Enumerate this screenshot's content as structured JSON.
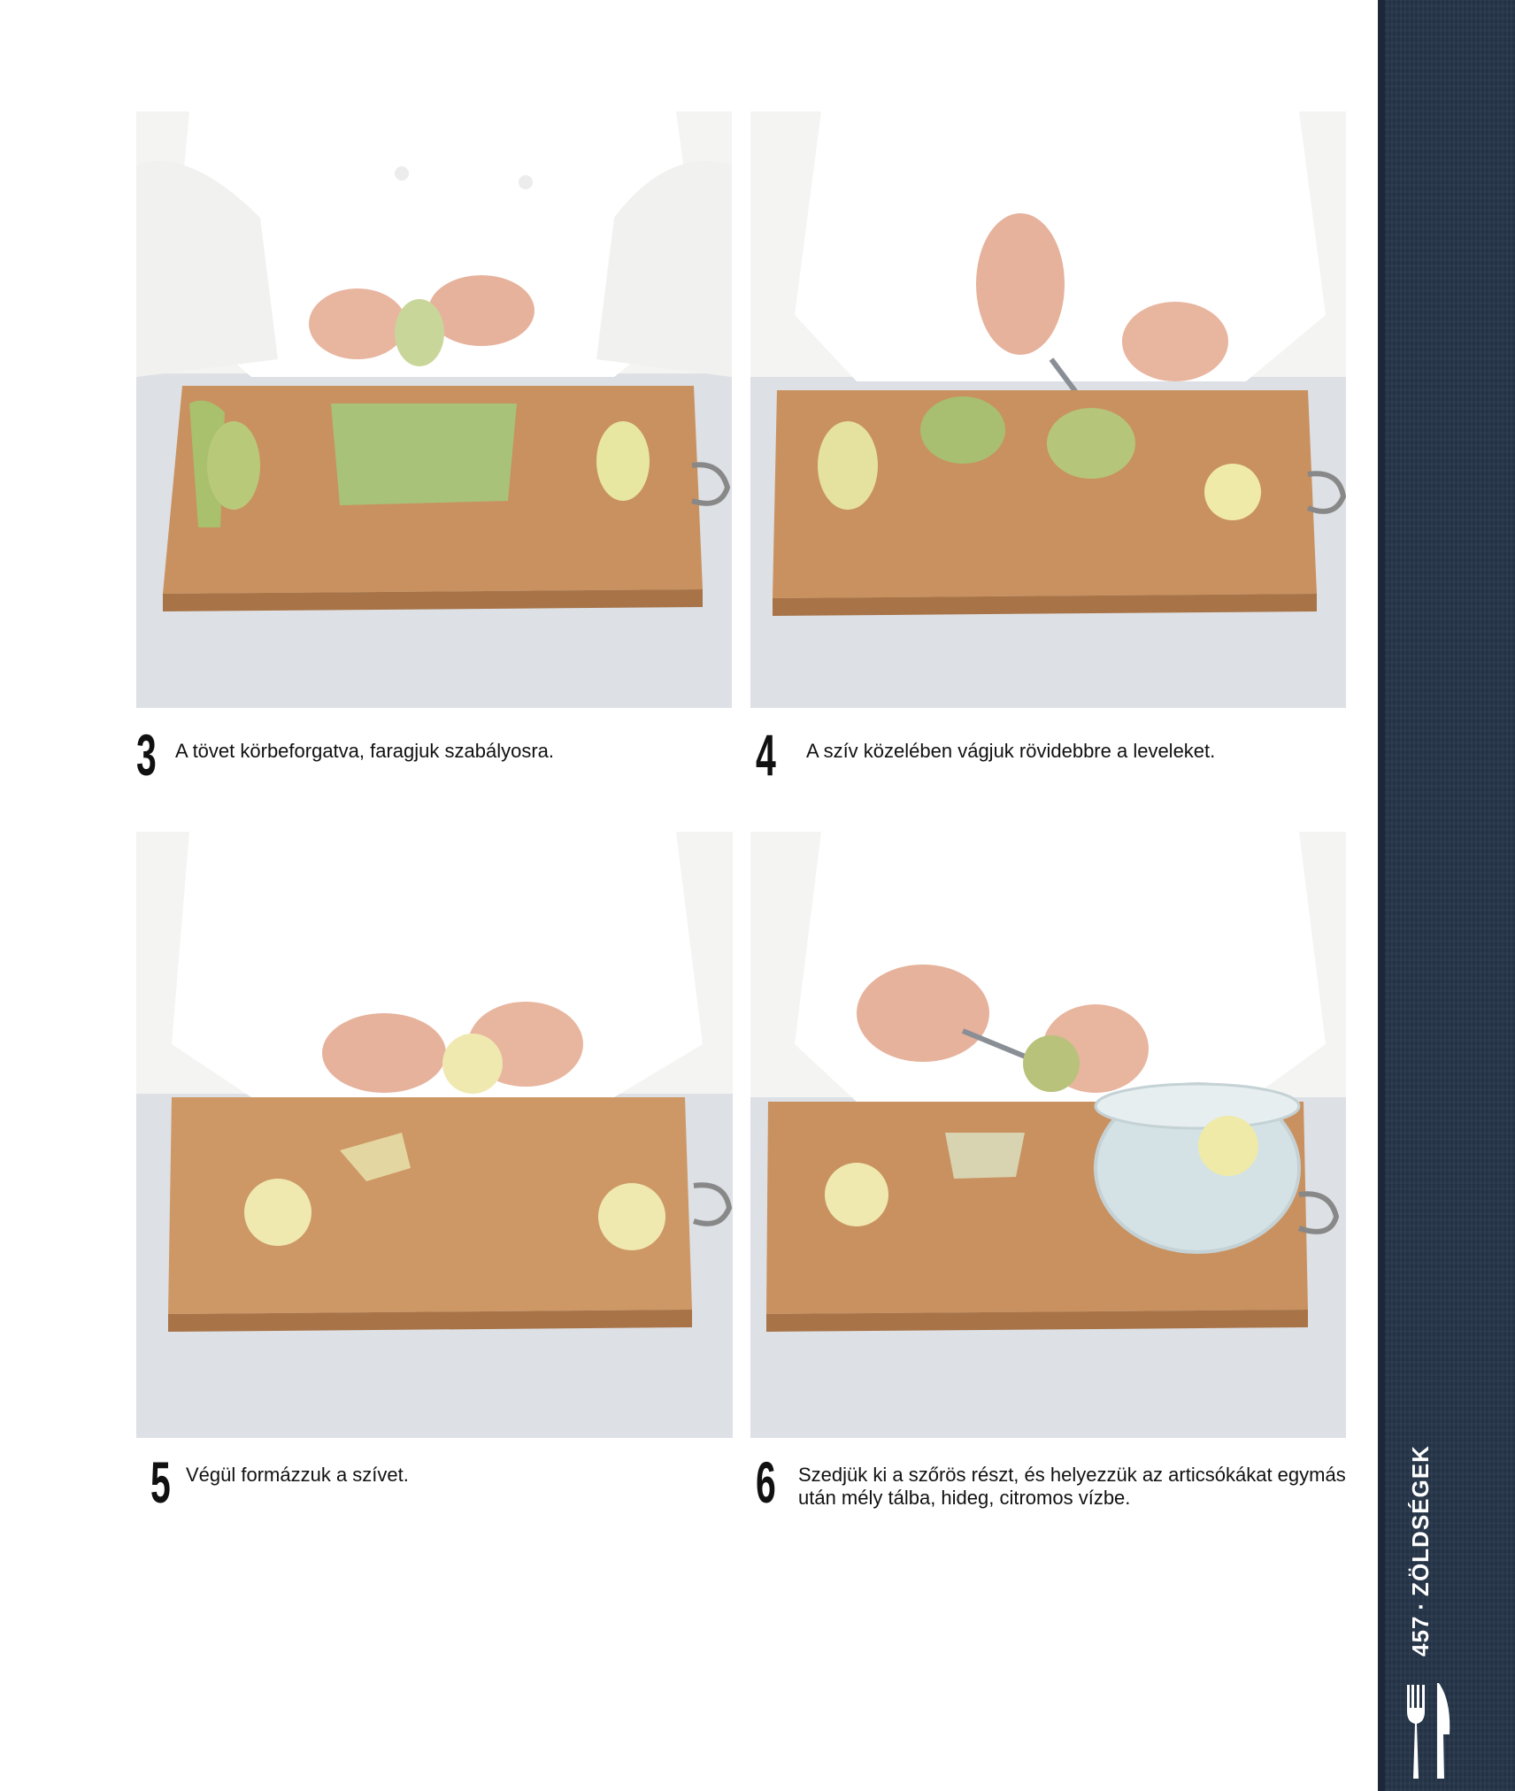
{
  "steps": [
    {
      "number": "3",
      "caption": "A tövet körbeforgatva, faragjuk szabályosra."
    },
    {
      "number": "4",
      "caption": "A szív közelében vágjuk rövidebbre a leveleket."
    },
    {
      "number": "5",
      "caption": "Végül formázzuk a szívet."
    },
    {
      "number": "6",
      "caption_line1": "Szedjük ki a szőrös részt, és helyezzük az articsókákat egymás",
      "caption_line2": "után mély tálba, hideg, citromos vízbe."
    }
  ],
  "sidebar": {
    "page_number": "457",
    "separator": "·",
    "section": "ZÖLDSÉGEK",
    "icon": "fork-and-knife-icon"
  }
}
